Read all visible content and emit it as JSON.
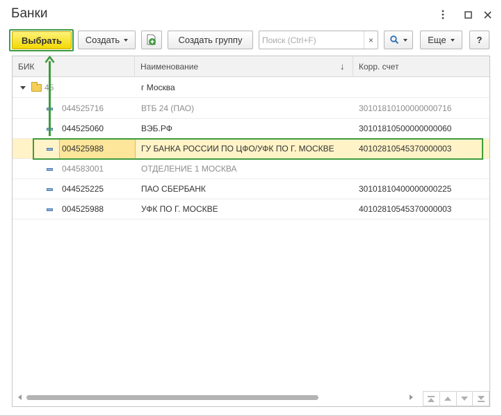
{
  "window": {
    "title": "Банки"
  },
  "toolbar": {
    "select_label": "Выбрать",
    "create_label": "Создать",
    "create_group_label": "Создать группу",
    "search_placeholder": "Поиск (Ctrl+F)",
    "search_clear": "×",
    "more_label": "Еще",
    "help_label": "?"
  },
  "table": {
    "columns": [
      "БИК",
      "Наименование",
      "Корр. счет"
    ],
    "sort_indicator": "↓",
    "folder": {
      "bik": "45",
      "name": "г Москва",
      "account": ""
    },
    "rows": [
      {
        "bik": "044525716",
        "name": "ВТБ 24 (ПАО)",
        "account": "30101810100000000716",
        "muted": true
      },
      {
        "bik": "044525060",
        "name": "ВЭБ.РФ",
        "account": "30101810500000000060",
        "muted": false
      },
      {
        "bik": "004525988",
        "name": "ГУ БАНКА РОССИИ ПО ЦФО/УФК ПО Г. МОСКВЕ",
        "account": "40102810545370000003",
        "muted": false,
        "selected": true
      },
      {
        "bik": "044583001",
        "name": "ОТДЕЛЕНИЕ 1 МОСКВА",
        "account": "",
        "muted": true
      },
      {
        "bik": "044525225",
        "name": "ПАО СБЕРБАНК",
        "account": "30101810400000000225",
        "muted": false
      },
      {
        "bik": "004525988",
        "name": "УФК ПО Г. МОСКВЕ",
        "account": "40102810545370000003",
        "muted": false
      }
    ]
  },
  "colors": {
    "accent_green": "#3d9b3d",
    "select_button_yellow": "#f5dc0a",
    "selected_row": "#fff3c7"
  }
}
